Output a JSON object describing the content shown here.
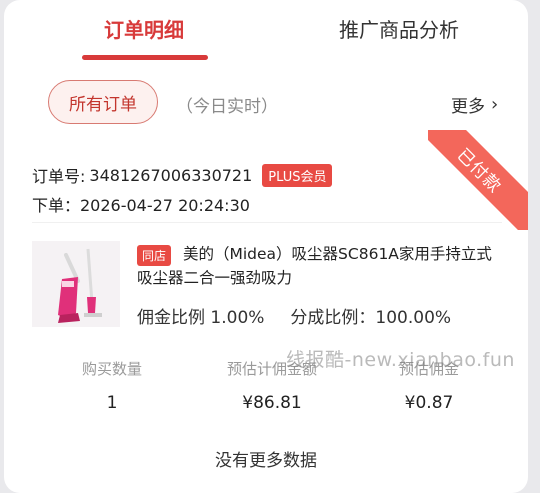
{
  "tabs": {
    "active": "订单明细",
    "inactive": "推广商品分析"
  },
  "filter": {
    "pill": "所有订单",
    "hint": "（今日实时）",
    "more": "更多"
  },
  "ribbon": "已付款",
  "order": {
    "number_label": "订单号:",
    "number": "3481267006330721",
    "plus_badge": "PLUS会员",
    "placed": "下单：2026-04-27 20:24:30"
  },
  "product": {
    "shop_badge": "同店",
    "title": "美的（Midea）吸尘器SC861A家用手持立式吸尘器二合一强劲吸力",
    "commission_rate": "佣金比例 1.00%",
    "share_rate": "分成比例：100.00%"
  },
  "stats": [
    {
      "label": "购买数量",
      "value": "1"
    },
    {
      "label": "预估计佣金额",
      "value": "¥86.81"
    },
    {
      "label": "预估佣金",
      "value": "¥0.87"
    }
  ],
  "footer": "没有更多数据",
  "watermark": "线报酷-new.xianbao.fun",
  "colors": {
    "accent": "#d83a3a",
    "ribbon": "#f3675b",
    "badge": "#e84a43"
  }
}
